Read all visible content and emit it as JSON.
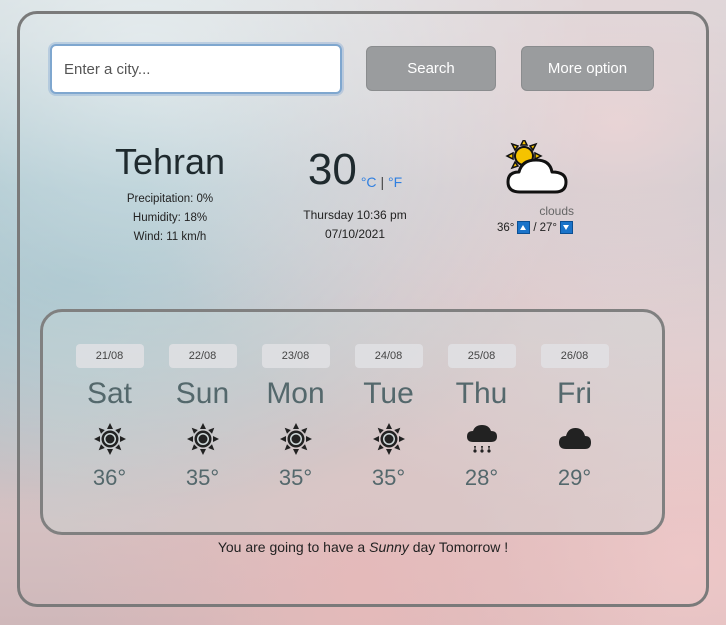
{
  "search": {
    "placeholder": "Enter a city...",
    "button_label": "Search"
  },
  "more_option_label": "More option",
  "current": {
    "city": "Tehran",
    "precipitation": "Precipitation: 0%",
    "humidity": "Humidity: 18%",
    "wind": "Wind: 11 km/h",
    "temperature": "30",
    "unit_c": "°C",
    "unit_sep": "|",
    "unit_f": "°F",
    "datetime": "Thursday 10:36 pm",
    "date": "07/10/2021",
    "condition_icon": "partly-cloudy-icon",
    "description": "clouds",
    "max": "36°",
    "min_sep": "/",
    "min": "27°"
  },
  "forecast": [
    {
      "date": "21/08",
      "day": "Sat",
      "icon": "sun-icon",
      "temp": "36°"
    },
    {
      "date": "22/08",
      "day": "Sun",
      "icon": "sun-icon",
      "temp": "35°"
    },
    {
      "date": "23/08",
      "day": "Mon",
      "icon": "sun-icon",
      "temp": "35°"
    },
    {
      "date": "24/08",
      "day": "Tue",
      "icon": "sun-icon",
      "temp": "35°"
    },
    {
      "date": "25/08",
      "day": "Thu",
      "icon": "rain-cloud-icon",
      "temp": "28°"
    },
    {
      "date": "26/08",
      "day": "Fri",
      "icon": "cloud-icon",
      "temp": "29°"
    }
  ],
  "summary": {
    "prefix": "You are going to have a",
    "condition": "Sunny",
    "suffix": "day Tomorrow !"
  },
  "colors": {
    "accent": "#2f7fe0",
    "button": "#9a9c9e",
    "forecast_text": "#54686c"
  }
}
